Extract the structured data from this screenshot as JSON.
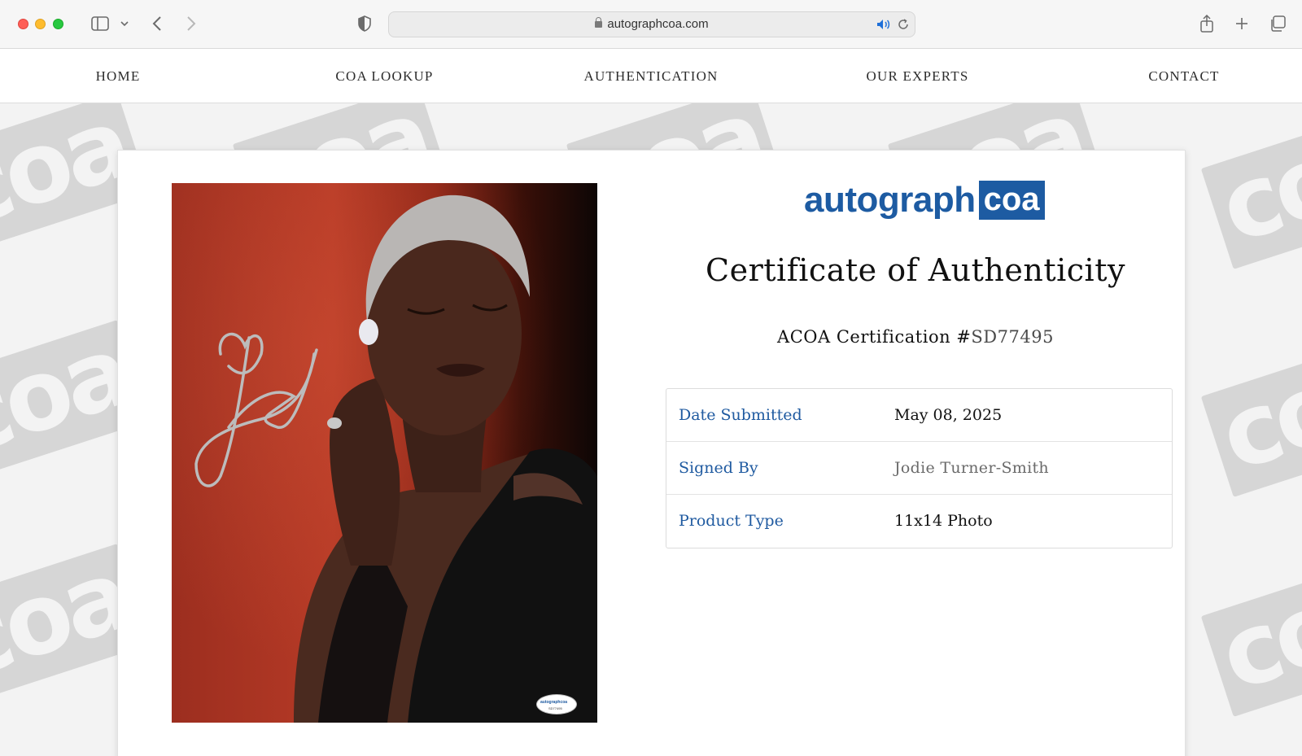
{
  "browser": {
    "url": "autographcoa.com"
  },
  "nav": {
    "items": [
      {
        "label": "HOME"
      },
      {
        "label": "COA LOOKUP"
      },
      {
        "label": "AUTHENTICATION"
      },
      {
        "label": "OUR EXPERTS"
      },
      {
        "label": "CONTACT"
      }
    ]
  },
  "watermark": {
    "text": "coa"
  },
  "logo": {
    "part1": "autograph",
    "part2": "coa",
    "brand_color": "#1d5ba2"
  },
  "certificate": {
    "title": "Certificate of Authenticity",
    "number_prefix": "ACOA Certification #",
    "number": "SD77495",
    "rows": [
      {
        "label": "Date Submitted",
        "value": "May 08, 2025"
      },
      {
        "label": "Signed By",
        "value": "Jodie Turner-Smith"
      },
      {
        "label": "Product Type",
        "value": "11x14 Photo"
      }
    ]
  },
  "photo": {
    "stamp_brand": "autographcoa",
    "stamp_number": "SD77495"
  }
}
